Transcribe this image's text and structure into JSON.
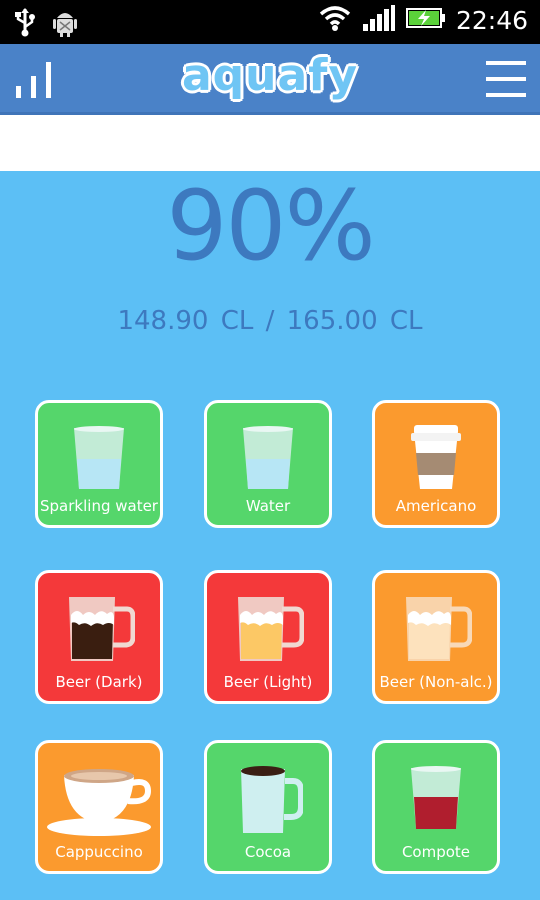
{
  "status_bar": {
    "time": "22:46"
  },
  "app": {
    "name": "aquafy"
  },
  "colors": {
    "green": "#55d66b",
    "orange": "#fb9a2e",
    "red": "#f4393a",
    "blue_text": "#3d79bf",
    "bg": "#5cbff5",
    "appbar": "#4a82c8"
  },
  "progress": {
    "fraction": 0.9
  },
  "summary": {
    "percent": "90%",
    "amounts": "148.90 CL  /  165.00 CL"
  },
  "drinks": [
    {
      "label": "Sparkling water",
      "icon": "glass-water-icon",
      "color": "green"
    },
    {
      "label": "Water",
      "icon": "glass-water-icon",
      "color": "green"
    },
    {
      "label": "Americano",
      "icon": "coffee-cup-icon",
      "color": "orange"
    },
    {
      "label": "Beer (Dark)",
      "icon": "beer-mug-dark-icon",
      "color": "red"
    },
    {
      "label": "Beer (Light)",
      "icon": "beer-mug-light-icon",
      "color": "red"
    },
    {
      "label": "Beer (Non-alc.)",
      "icon": "beer-mug-nonalc-icon",
      "color": "orange"
    },
    {
      "label": "Cappuccino",
      "icon": "cappuccino-cup-icon",
      "color": "orange"
    },
    {
      "label": "Cocoa",
      "icon": "cocoa-mug-icon",
      "color": "green"
    },
    {
      "label": "Compote",
      "icon": "glass-compote-icon",
      "color": "green"
    }
  ]
}
